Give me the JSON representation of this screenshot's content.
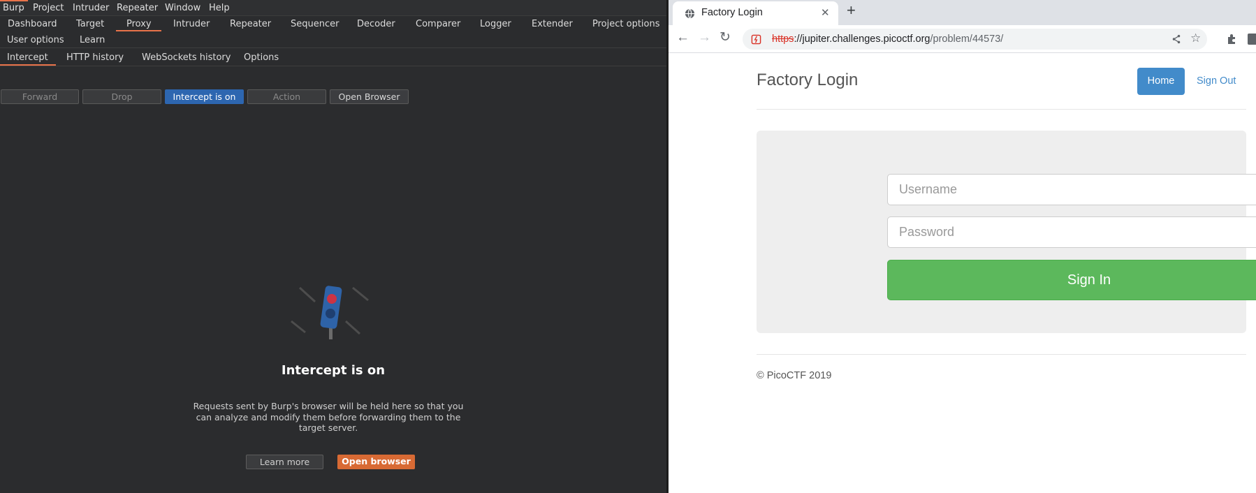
{
  "burp": {
    "menu": [
      "Burp",
      "Project",
      "Intruder",
      "Repeater",
      "Window",
      "Help"
    ],
    "main_tabs": [
      "Dashboard",
      "Target",
      "Proxy",
      "Intruder",
      "Repeater",
      "Sequencer",
      "Decoder",
      "Comparer",
      "Logger",
      "Extender",
      "Project options",
      "User options",
      "Learn"
    ],
    "active_main_tab": "Proxy",
    "sub_tabs": [
      "Intercept",
      "HTTP history",
      "WebSockets history",
      "Options"
    ],
    "active_sub_tab": "Intercept",
    "toolbar": {
      "forward": "Forward",
      "drop": "Drop",
      "intercept": "Intercept is on",
      "action": "Action",
      "open_browser": "Open Browser"
    },
    "empty_state": {
      "title": "Intercept is on",
      "description": "Requests sent by Burp's browser will be held here so that you can analyze and modify them before forwarding them to the target server.",
      "learn_more": "Learn more",
      "open_browser": "Open browser"
    },
    "colors": {
      "accent": "#e8734a",
      "active_button": "#2d66b0"
    }
  },
  "browser": {
    "tab_title": "Factory Login",
    "url_scheme": "https",
    "url_host": "://jupiter.challenges.picoctf.org",
    "url_path": "/problem/44573/",
    "page": {
      "title": "Factory Login",
      "nav": {
        "home": "Home",
        "sign_out": "Sign Out"
      },
      "form": {
        "username_placeholder": "Username",
        "password_placeholder": "Password",
        "submit": "Sign In"
      },
      "footer": "© PicoCTF 2019"
    },
    "colors": {
      "primary": "#428bca",
      "success": "#5cb85c",
      "insecure": "#d93025"
    }
  }
}
